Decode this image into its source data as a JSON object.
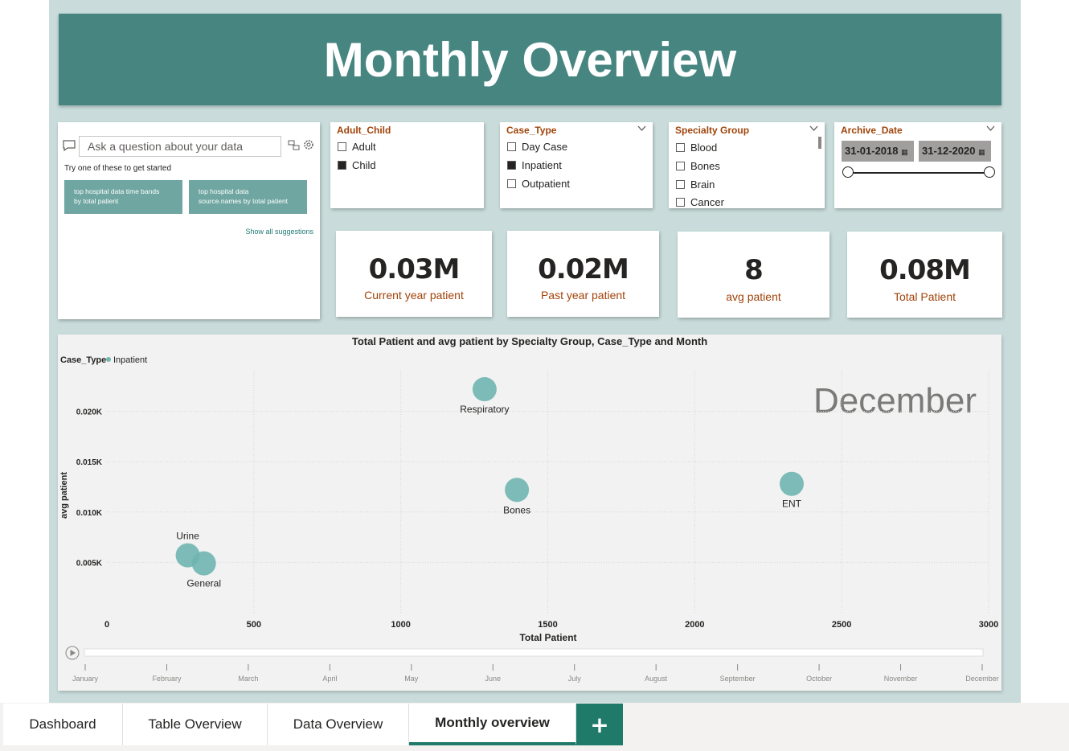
{
  "page": {
    "title": "Monthly Overview"
  },
  "qna": {
    "placeholder": "Ask a question about your data",
    "hint": "Try one of these to get started",
    "suggestions": [
      {
        "line1": "top hospital data time bands",
        "line2": "by total patient"
      },
      {
        "line1": "top hospital data",
        "line2": "source.names by total patient"
      }
    ],
    "show_all": "Show all suggestions"
  },
  "slicers": {
    "adult_child": {
      "title": "Adult_Child",
      "options": [
        {
          "label": "Adult",
          "checked": false
        },
        {
          "label": "Child",
          "checked": true
        }
      ]
    },
    "case_type": {
      "title": "Case_Type",
      "options": [
        {
          "label": "Day Case",
          "checked": false
        },
        {
          "label": "Inpatient",
          "checked": true
        },
        {
          "label": "Outpatient",
          "checked": false
        }
      ]
    },
    "specialty": {
      "title": "Specialty Group",
      "options": [
        {
          "label": "Blood",
          "checked": false
        },
        {
          "label": "Bones",
          "checked": false
        },
        {
          "label": "Brain",
          "checked": false
        },
        {
          "label": "Cancer",
          "checked": false
        }
      ]
    },
    "archive_date": {
      "title": "Archive_Date",
      "start": "31-01-2018",
      "end": "31-12-2020",
      "range": [
        0,
        1
      ]
    }
  },
  "kpis": [
    {
      "value": "0.03M",
      "label": "Current year patient"
    },
    {
      "value": "0.02M",
      "label": "Past year patient"
    },
    {
      "value": "8",
      "label": "avg patient"
    },
    {
      "value": "0.08M",
      "label": "Total Patient"
    }
  ],
  "chart_data": {
    "type": "scatter",
    "title": "Total Patient and avg patient by Specialty Group, Case_Type and Month",
    "legend_title": "Case_Type",
    "legend_items": [
      "Inpatient"
    ],
    "xlabel": "Total Patient",
    "ylabel": "avg patient",
    "xlim": [
      0,
      3000
    ],
    "ylim": [
      0,
      0.025
    ],
    "x_ticks": [
      "0",
      "500",
      "1000",
      "1500",
      "2000",
      "2500",
      "3000"
    ],
    "y_ticks": [
      {
        "value": 0.005,
        "label": "0.005K"
      },
      {
        "value": 0.01,
        "label": "0.010K"
      },
      {
        "value": 0.015,
        "label": "0.015K"
      },
      {
        "value": 0.02,
        "label": "0.020K"
      }
    ],
    "play_label": "December",
    "points": [
      {
        "label": "Respiratory",
        "x": 1285,
        "y": 0.0222,
        "label_pos": "below"
      },
      {
        "label": "Bones",
        "x": 1395,
        "y": 0.0122,
        "label_pos": "below"
      },
      {
        "label": "ENT",
        "x": 2330,
        "y": 0.0128,
        "label_pos": "below"
      },
      {
        "label": "Urine",
        "x": 275,
        "y": 0.0057,
        "label_pos": "above"
      },
      {
        "label": "General",
        "x": 330,
        "y": 0.0049,
        "label_pos": "below"
      }
    ],
    "color": "#6fb5b0",
    "grid": true,
    "months": [
      "January",
      "February",
      "March",
      "April",
      "May",
      "June",
      "July",
      "August",
      "September",
      "October",
      "November",
      "December"
    ]
  },
  "tabs": [
    {
      "label": "Dashboard",
      "active": false
    },
    {
      "label": "Table Overview",
      "active": false
    },
    {
      "label": "Data Overview",
      "active": false
    },
    {
      "label": "Monthly overview",
      "active": true
    }
  ],
  "add_tab": "+"
}
